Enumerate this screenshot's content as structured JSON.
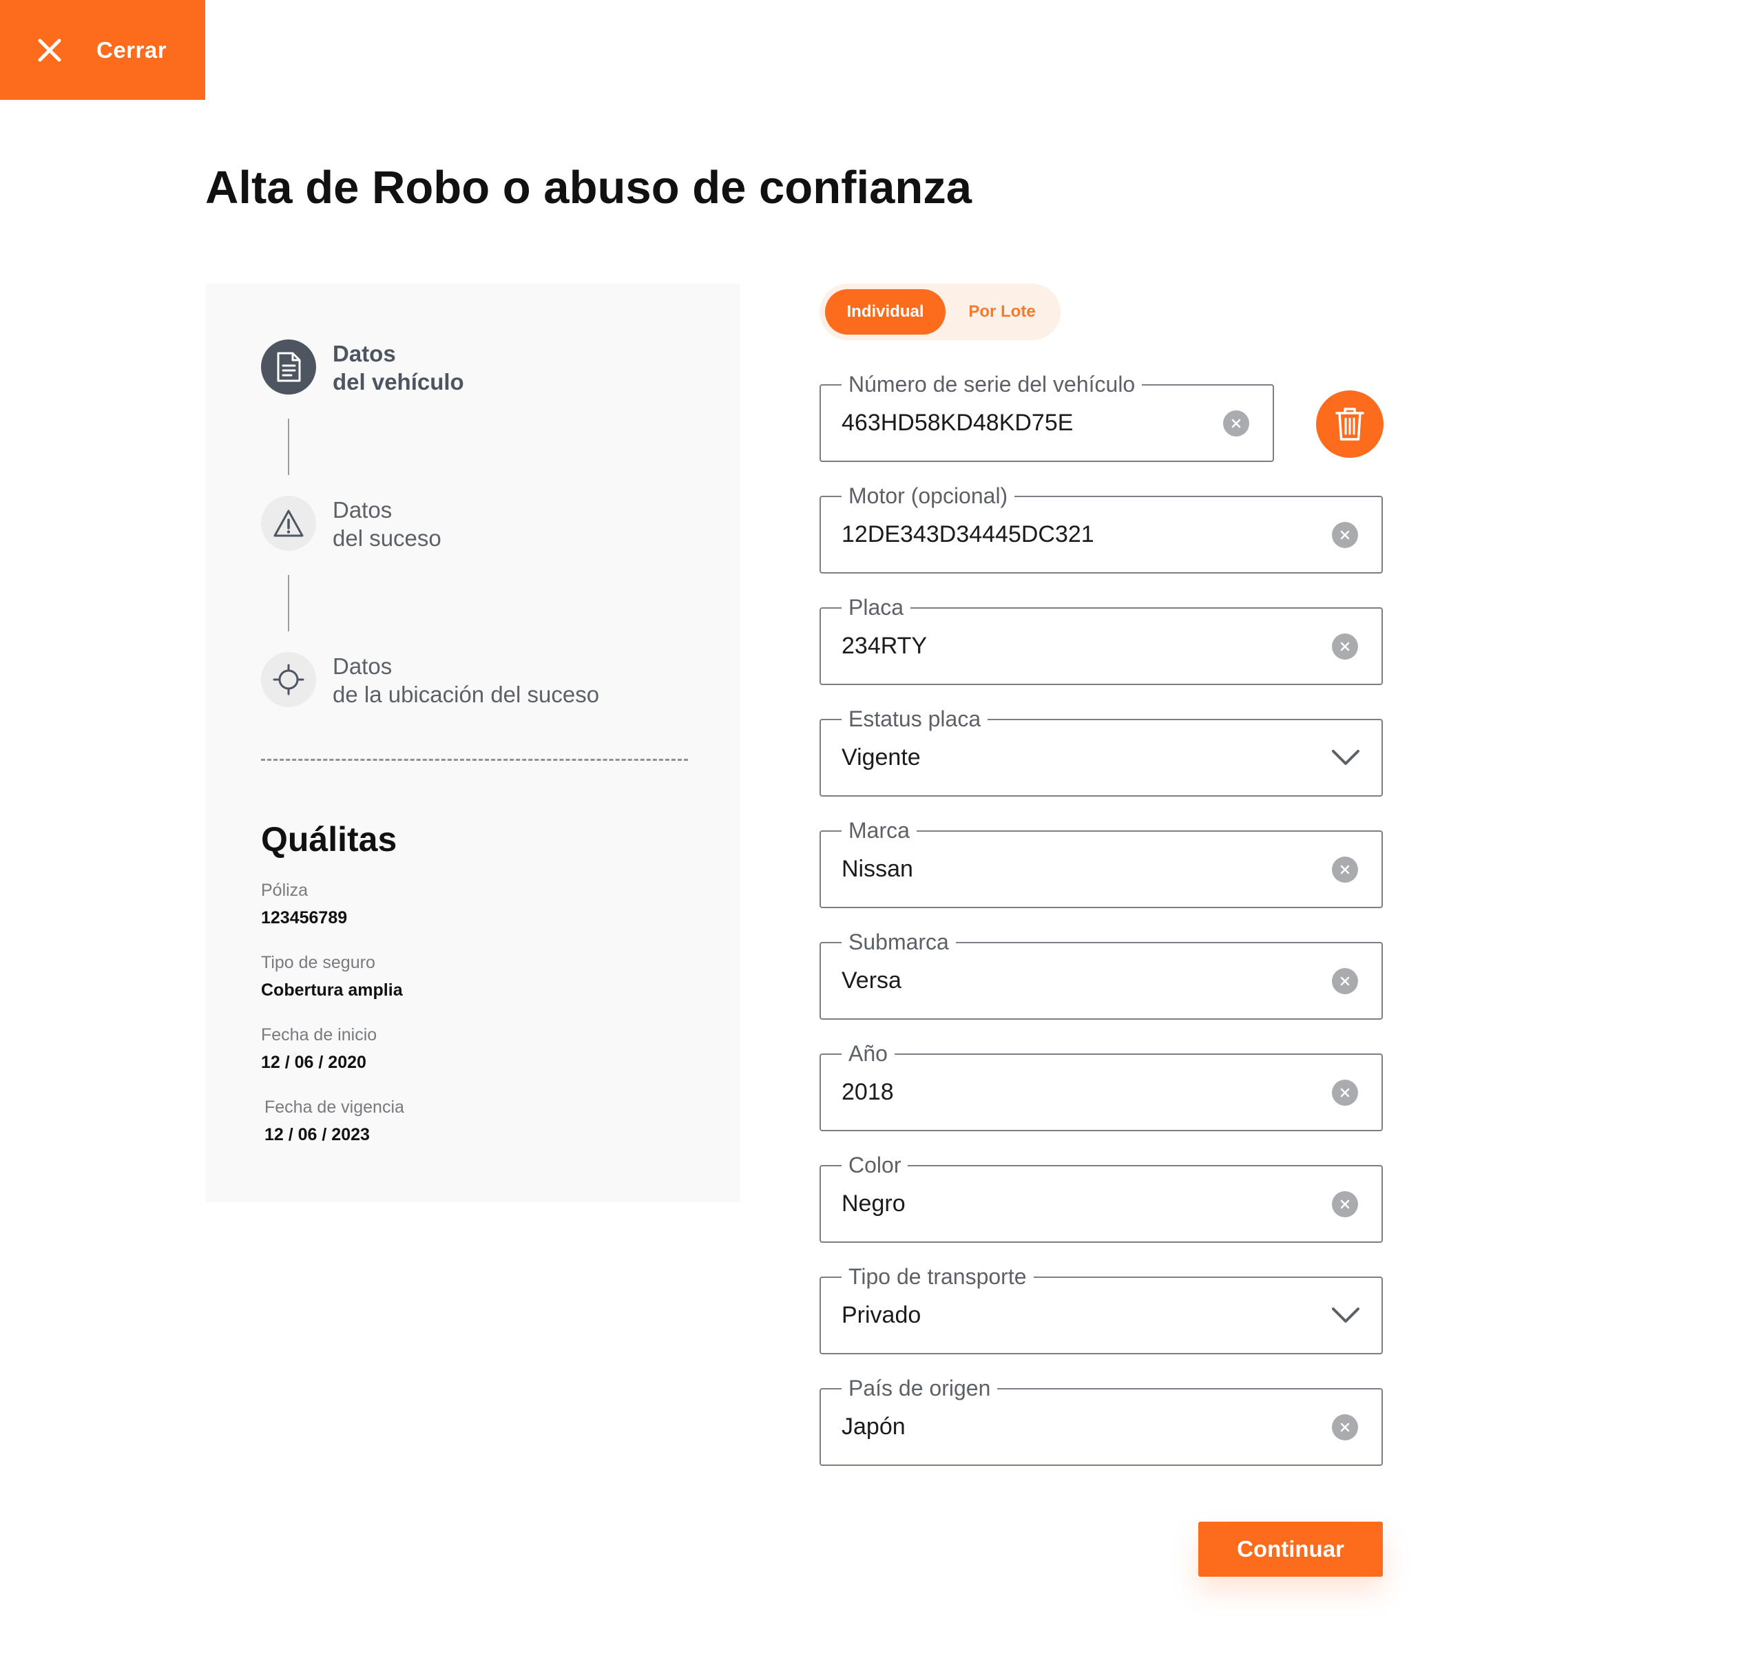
{
  "header": {
    "close_label": "Cerrar"
  },
  "page_title": "Alta de Robo o abuso de confianza",
  "steps": [
    {
      "line1": "Datos",
      "line2": "del vehículo",
      "icon": "document-icon",
      "active": true
    },
    {
      "line1": "Datos",
      "line2": "del suceso",
      "icon": "warning-icon",
      "active": false
    },
    {
      "line1": "Datos",
      "line2": "de la ubicación del suceso",
      "icon": "crosshair-icon",
      "active": false
    }
  ],
  "insurer": {
    "name": "Quálitas",
    "poliza_label": "Póliza",
    "poliza_value": "123456789",
    "tipo_label": "Tipo de seguro",
    "tipo_value": "Cobertura amplia",
    "inicio_label": "Fecha de inicio",
    "inicio_value": "12 / 06 / 2020",
    "vigencia_label": "Fecha de vigencia",
    "vigencia_value": "12 / 06 / 2023"
  },
  "mode_toggle": {
    "individual": "Individual",
    "lote": "Por Lote",
    "selected": "Individual"
  },
  "fields": [
    {
      "label": "Número de serie del vehículo",
      "value": "463HD58KD48KD75E",
      "type": "text"
    },
    {
      "label": "Motor (opcional)",
      "value": "12DE343D34445DC321",
      "type": "text"
    },
    {
      "label": "Placa",
      "value": "234RTY",
      "type": "text"
    },
    {
      "label": "Estatus placa",
      "value": "Vigente",
      "type": "select"
    },
    {
      "label": "Marca",
      "value": "Nissan",
      "type": "text"
    },
    {
      "label": "Submarca",
      "value": "Versa",
      "type": "text"
    },
    {
      "label": "Año",
      "value": "2018",
      "type": "text"
    },
    {
      "label": "Color",
      "value": "Negro",
      "type": "text"
    },
    {
      "label": "Tipo de transporte",
      "value": "Privado",
      "type": "select"
    },
    {
      "label": "País de origen",
      "value": "Japón",
      "type": "text"
    }
  ],
  "continue_label": "Continuar",
  "colors": {
    "accent": "#fd6b1c",
    "step_active": "#4d5560",
    "panel_bg": "#f9f9f9",
    "toggle_bg": "#fdf0e6"
  }
}
